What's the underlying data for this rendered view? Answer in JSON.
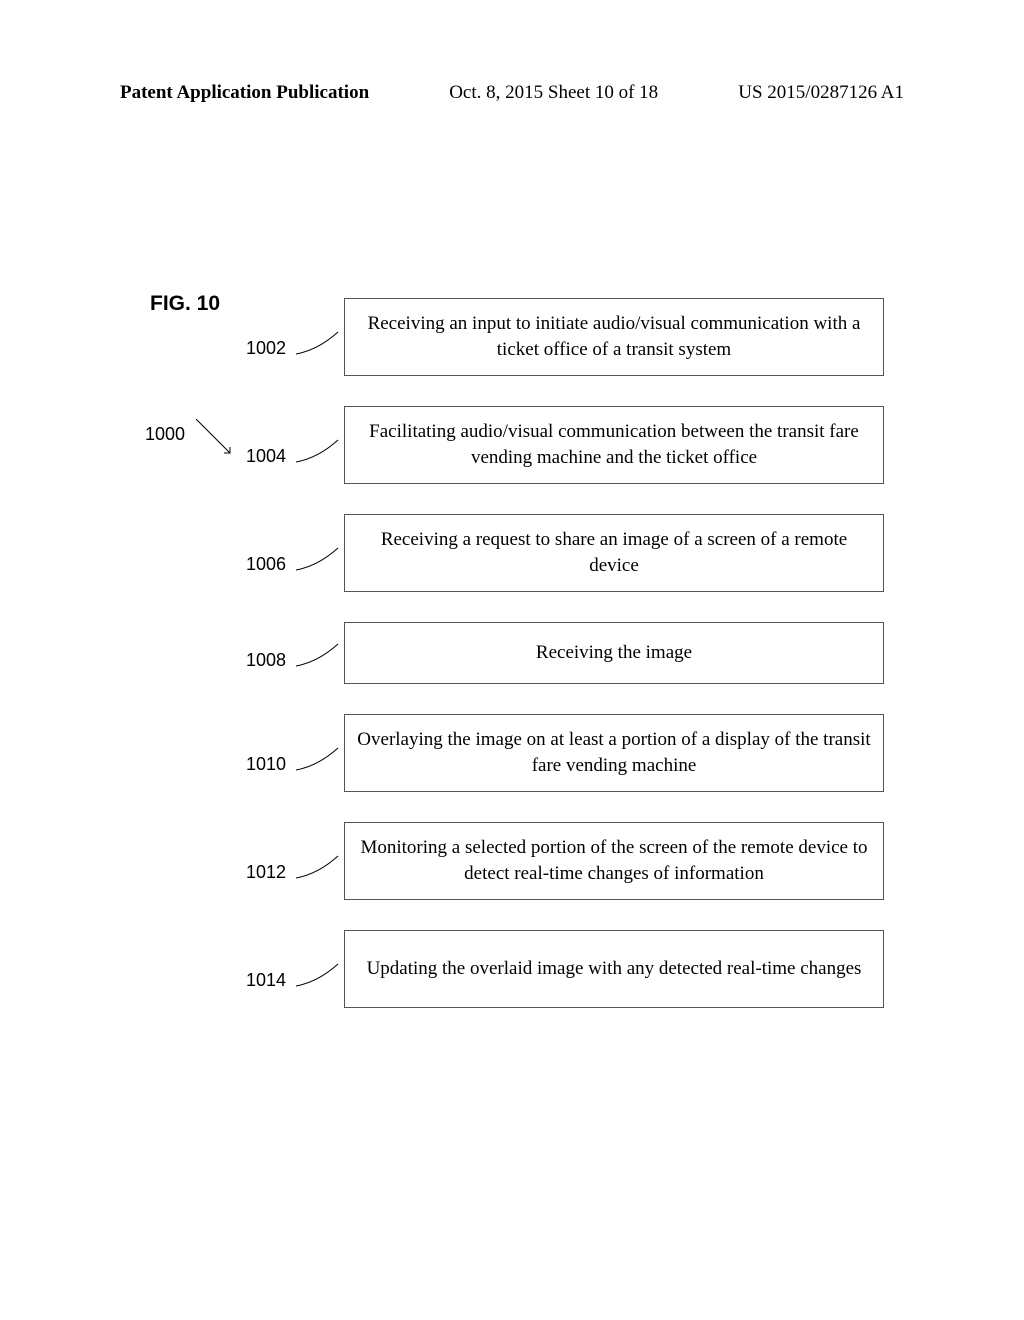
{
  "header": {
    "left": "Patent Application Publication",
    "center": "Oct. 8, 2015   Sheet 10 of 18",
    "right": "US 2015/0287126 A1"
  },
  "figure": {
    "label": "FIG. 10",
    "overall_ref": "1000"
  },
  "steps": [
    {
      "ref": "1002",
      "text": "Receiving an input to initiate audio/visual communication with a ticket office of a transit system"
    },
    {
      "ref": "1004",
      "text": "Facilitating audio/visual communication between the transit fare vending machine and the ticket office"
    },
    {
      "ref": "1006",
      "text": "Receiving a request to share an image of a screen of a remote device"
    },
    {
      "ref": "1008",
      "text": "Receiving the image"
    },
    {
      "ref": "1010",
      "text": "Overlaying the image on at least a portion of a display of the transit fare vending machine"
    },
    {
      "ref": "1012",
      "text": "Monitoring a selected portion of the screen of the remote device to detect real-time changes of information"
    },
    {
      "ref": "1014",
      "text": "Updating the overlaid image with any detected real-time changes"
    }
  ]
}
